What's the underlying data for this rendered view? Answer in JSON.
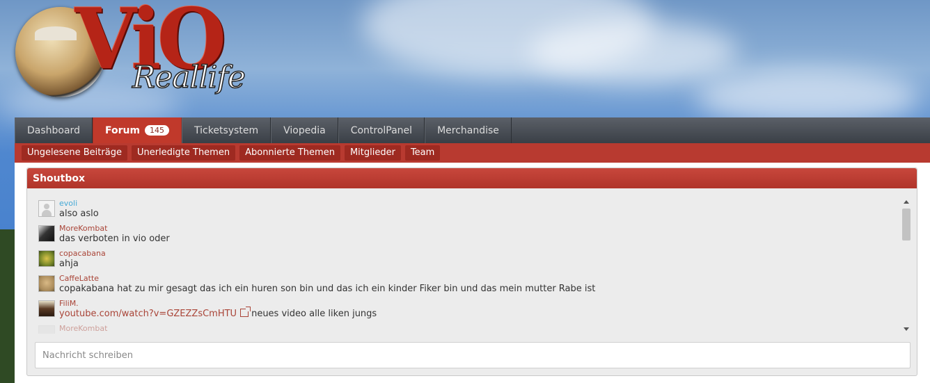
{
  "logo": {
    "main_text": "ViO",
    "sub_text": "Reallife"
  },
  "nav": {
    "items": [
      {
        "label": "Dashboard"
      },
      {
        "label": "Forum",
        "badge": "145",
        "active": true
      },
      {
        "label": "Ticketsystem"
      },
      {
        "label": "Viopedia"
      },
      {
        "label": "ControlPanel"
      },
      {
        "label": "Merchandise"
      }
    ]
  },
  "subnav": {
    "items": [
      {
        "label": "Ungelesene Beiträge"
      },
      {
        "label": "Unerledigte Themen"
      },
      {
        "label": "Abonnierte Themen"
      },
      {
        "label": "Mitglieder"
      },
      {
        "label": "Team"
      }
    ]
  },
  "shoutbox": {
    "title": "Shoutbox",
    "messages": [
      {
        "user": "evoli",
        "text": "also aslo"
      },
      {
        "user": "MoreKombat",
        "text": "das verboten in vio oder"
      },
      {
        "user": "copacabana",
        "text": "ahja"
      },
      {
        "user": "CaffeLatte",
        "text": "copakabana hat zu mir gesagt das ich ein huren son bin und das ich ein kinder Fiker bin und das mein mutter Rabe ist"
      },
      {
        "user": "FiliM.",
        "link": "youtube.com/watch?v=GZEZZsCmHTU",
        "text": "neues video alle liken jungs"
      },
      {
        "user": "MoreKombat",
        "text": ""
      }
    ],
    "input_placeholder": "Nachricht schreiben"
  },
  "colors": {
    "nav_active": "#c0392b",
    "subnav_bg": "#b83a30",
    "username": "#a94437",
    "username_alt": "#45a9d6"
  }
}
